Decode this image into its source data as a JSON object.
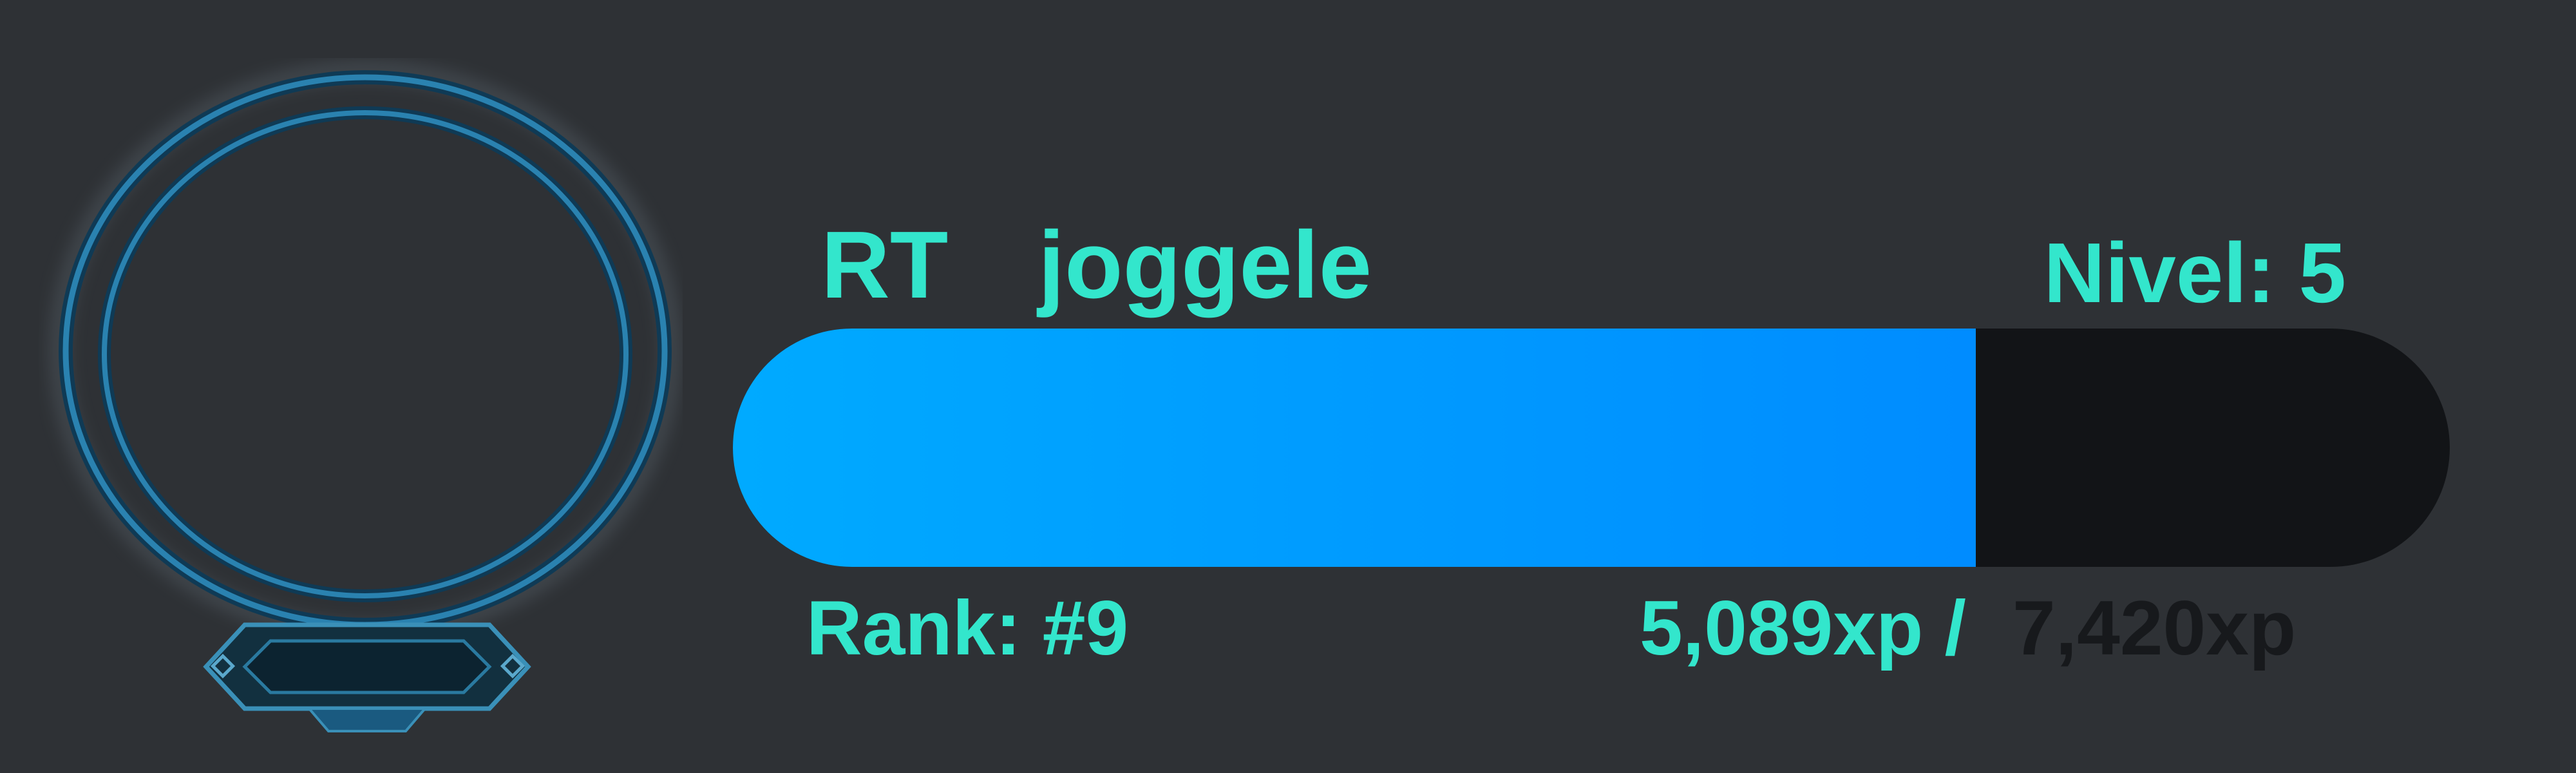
{
  "profile": {
    "prefix": "RT",
    "username": "joggele",
    "level_label": "Nivel: 5",
    "rank_label": "Rank: #9",
    "xp_current": "5,089xp /",
    "xp_total": "7,420xp",
    "progress_fraction": 0.724
  },
  "colors": {
    "accent_text": "#33e6cc",
    "background": "#2e3135",
    "bar_fill_start": "#00aaff",
    "bar_fill_end": "#008cff",
    "bar_track": "#121417",
    "xp_total_text": "#17191c",
    "frame": "#1f6f99"
  },
  "icons": {
    "avatar_frame": "avatar-frame-icon"
  }
}
